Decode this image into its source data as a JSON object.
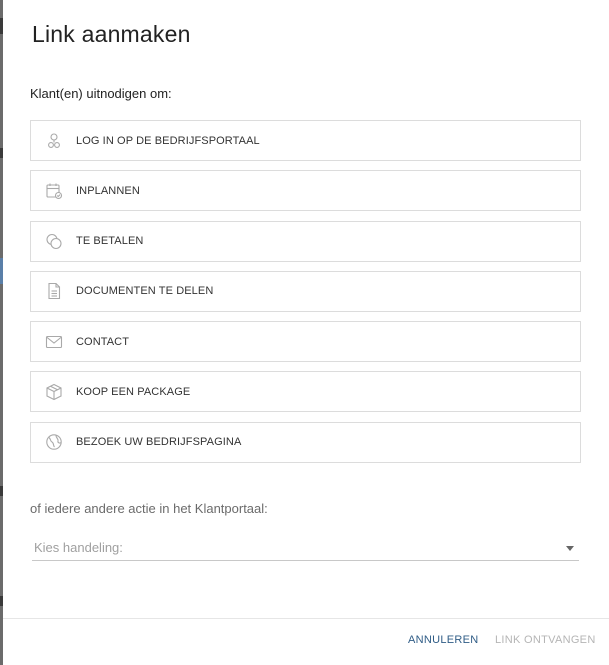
{
  "dialog": {
    "title": "Link aanmaken",
    "subtitle": "Klant(en) uitnodigen om:",
    "options": [
      {
        "label": "LOG IN OP DE BEDRIJFSPORTAAL",
        "icon": "user-icon"
      },
      {
        "label": "INPLANNEN",
        "icon": "calendar-icon"
      },
      {
        "label": "TE BETALEN",
        "icon": "coins-icon"
      },
      {
        "label": "DOCUMENTEN TE DELEN",
        "icon": "document-icon"
      },
      {
        "label": "CONTACT",
        "icon": "envelope-icon"
      },
      {
        "label": "KOOP EEN PACKAGE",
        "icon": "package-icon"
      },
      {
        "label": "BEZOEK UW BEDRIJFSPAGINA",
        "icon": "globe-icon"
      }
    ],
    "other_action_label": "of iedere andere actie in het Klantportaal:",
    "select": {
      "placeholder": "Kies handeling:"
    },
    "footer": {
      "cancel_label": "ANNULEREN",
      "get_link_label": "LINK ONTVANGEN"
    }
  },
  "colors": {
    "primary_button": "#2f5c86",
    "disabled_button": "#b5b5b5",
    "border": "#dcdcdc",
    "icon": "#a9a9a9"
  }
}
